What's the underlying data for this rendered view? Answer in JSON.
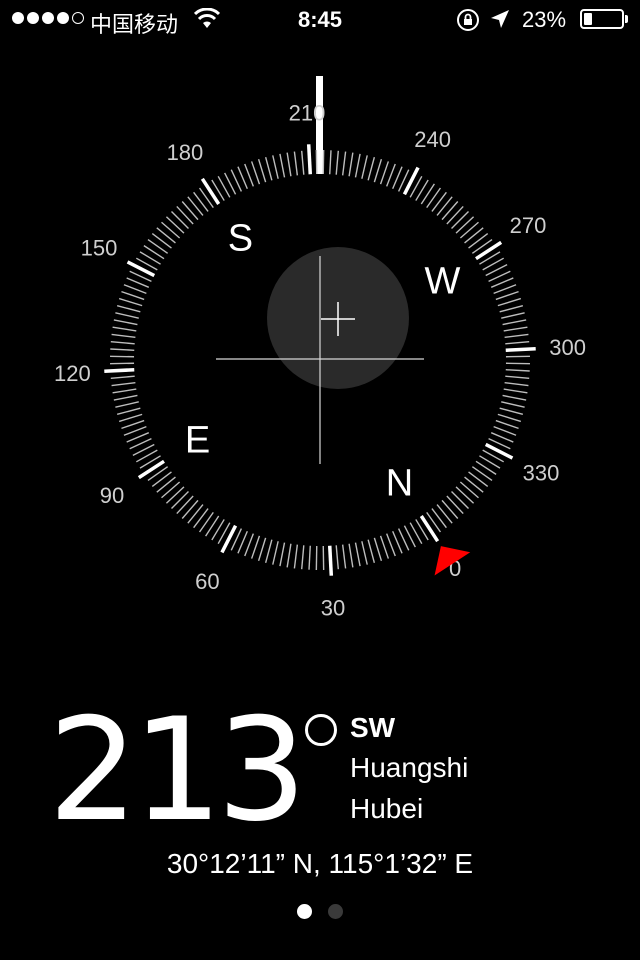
{
  "status_bar": {
    "carrier": "中国移动",
    "time": "8:45",
    "battery_percent": "23%",
    "battery_level": 0.23,
    "signal_bars_filled": 4,
    "signal_bars_total": 5,
    "icons": [
      "wifi-icon",
      "orientation-lock-icon",
      "location-arrow-icon",
      "battery-icon"
    ]
  },
  "compass": {
    "heading_degrees": 213,
    "degree_labels": [
      "0",
      "30",
      "60",
      "90",
      "120",
      "150",
      "180",
      "210",
      "240",
      "270",
      "300",
      "330"
    ],
    "cardinals": [
      "N",
      "E",
      "S",
      "W"
    ],
    "north_marker_color": "#ff0000",
    "level_bubble_color": "#2a2a2a"
  },
  "readout": {
    "heading": "213",
    "direction": "SW",
    "city": "Huangshi",
    "region": "Hubei",
    "coordinates": "30°12’11” N, 115°1’32” E"
  },
  "pager": {
    "pages": 2,
    "active": 0
  }
}
